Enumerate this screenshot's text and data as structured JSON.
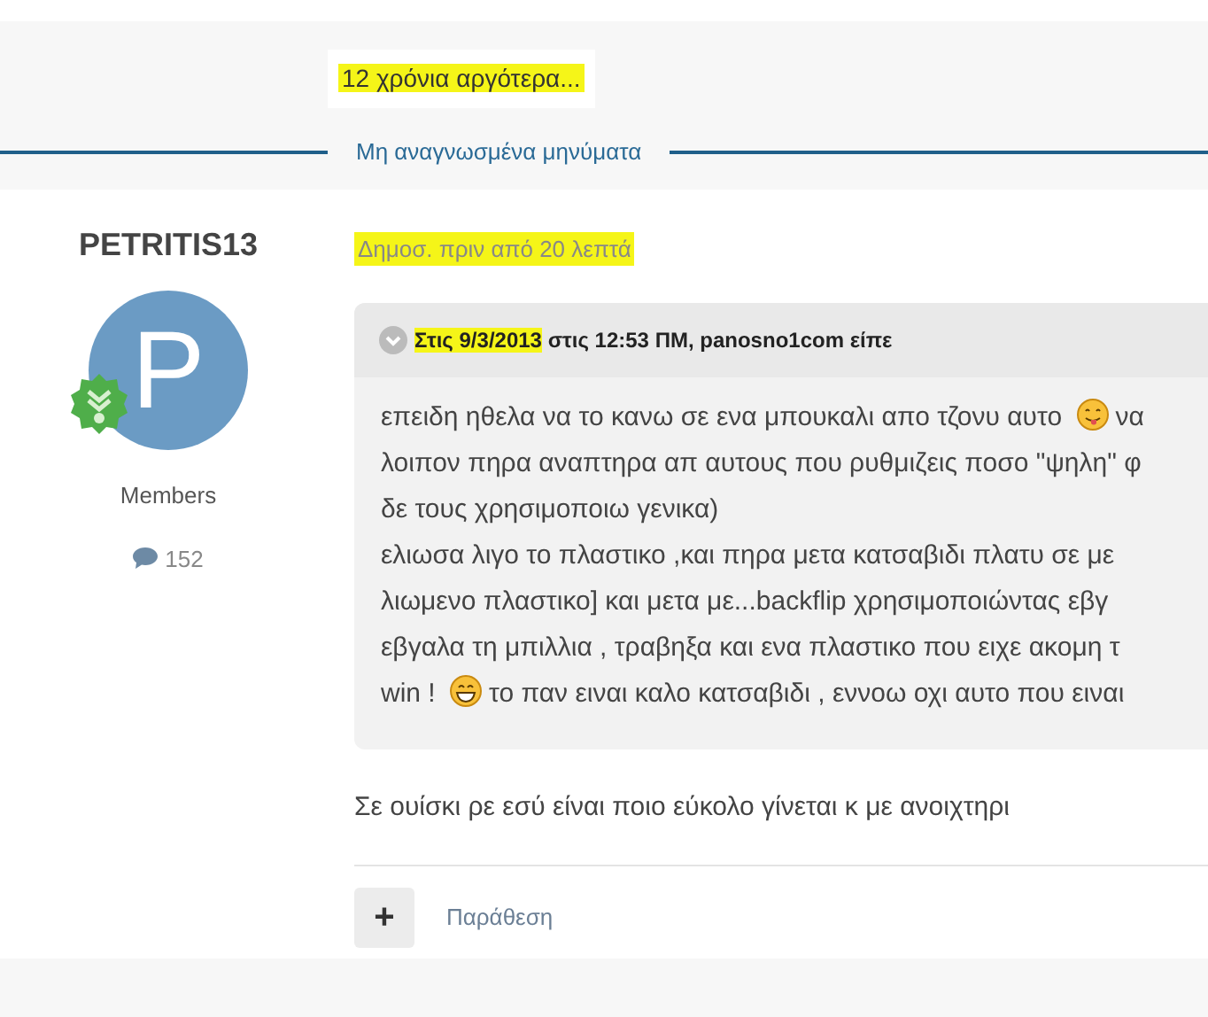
{
  "note": {
    "text": "12 χρόνια αργότερα...",
    "highlighted": true
  },
  "unread_divider": "Μη αναγνωσμένα μηνύματα",
  "post": {
    "author": {
      "name": "PETRITIS13",
      "avatar_letter": "P",
      "group": "Members",
      "posts": "152"
    },
    "meta": {
      "text": "Δημοσ. πριν από 20 λεπτά",
      "highlighted": true
    },
    "quote": {
      "header": [
        {
          "text": "Στις 9/3/2013",
          "highlighted": true
        },
        {
          "text": " στις 12:53 ΠΜ, panosno1com είπε",
          "highlighted": false
        }
      ],
      "lines": [
        [
          {
            "kind": "text",
            "text": "επειδη ηθελα να το κανω σε ενα μπουκαλι απο τζονυ αυτο"
          },
          {
            "kind": "tongue"
          },
          {
            "kind": "text",
            "text": "να"
          }
        ],
        [
          {
            "kind": "text",
            "text": "λοιπον πηρα αναπτηρα απ αυτους που ρυθμιζεις ποσο \"ψηλη\" φ"
          }
        ],
        [
          {
            "kind": "text",
            "text": "δε τους χρησιμοποιω γενικα)"
          }
        ],
        [
          {
            "kind": "text",
            "text": "ελιωσα λιγο το πλαστικο ,και πηρα μετα κατσαβιδι πλατυ σε με"
          }
        ],
        [
          {
            "kind": "text",
            "text": "λιωμενο πλαστικο] και μετα με...backflip χρησιμοποιώντας  εβγ"
          }
        ],
        [
          {
            "kind": "text",
            "text": "εβγαλα τη μπιλλια , τραβηξα και ενα πλαστικο που ειχε ακομη τ"
          }
        ],
        [
          {
            "kind": "text",
            "text": "win !"
          },
          {
            "kind": "grin"
          },
          {
            "kind": "text",
            "text": "το παν ειναι καλο κατσαβιδι , εννοω οχι αυτο που ειναι"
          }
        ]
      ]
    },
    "reply": "Σε ουίσκι ρε εσύ είναι ποιο εύκολο γίνεται κ με ανοιχτηρι",
    "actions": {
      "expand": "+",
      "quote": "Παράθεση"
    }
  }
}
